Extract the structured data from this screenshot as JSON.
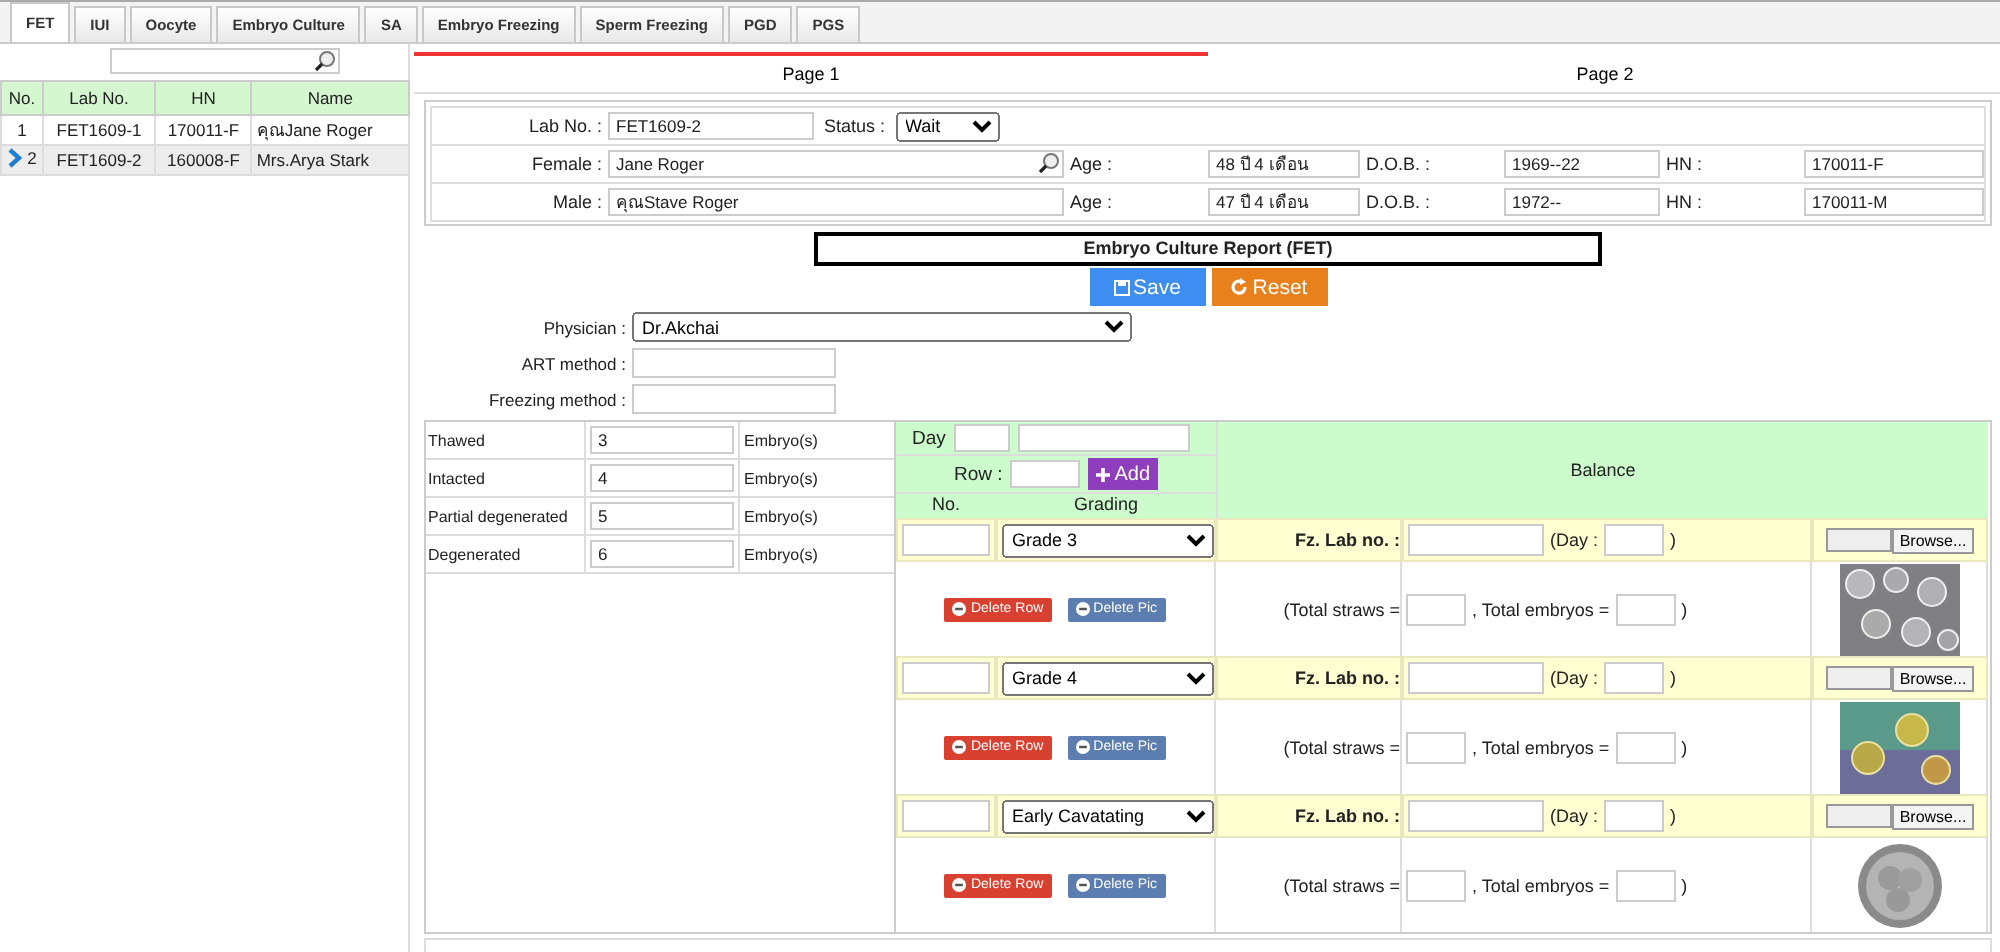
{
  "tabs": [
    {
      "label": "FET",
      "selected": true
    },
    {
      "label": "IUI",
      "selected": false
    },
    {
      "label": "Oocyte",
      "selected": false
    },
    {
      "label": "Embryo Culture",
      "selected": false
    },
    {
      "label": "SA",
      "selected": false
    },
    {
      "label": "Embryo Freezing",
      "selected": false
    },
    {
      "label": "Sperm Freezing",
      "selected": false
    },
    {
      "label": "PGD",
      "selected": false
    },
    {
      "label": "PGS",
      "selected": false
    }
  ],
  "patients": {
    "columns": [
      "No.",
      "Lab No.",
      "HN",
      "Name"
    ],
    "rows": [
      {
        "no": "1",
        "lab_no": "FET1609-1",
        "hn": "170011-F",
        "name": "คุณJane Roger",
        "selected": false
      },
      {
        "no": "2",
        "lab_no": "FET1609-2",
        "hn": "160008-F",
        "name": "Mrs.Arya Stark",
        "selected": true
      }
    ]
  },
  "pages": [
    {
      "label": "Page 1",
      "selected": true
    },
    {
      "label": "Page 2",
      "selected": false
    }
  ],
  "info": {
    "lab_no_label": "Lab No. :",
    "lab_no": "FET1609-2",
    "status_label": "Status :",
    "status": "Wait",
    "people": [
      {
        "label": "Female :",
        "name": "Jane Roger",
        "search": true,
        "age_label": "Age :",
        "age": "48 ปี 4 เดือน",
        "dob_label": "D.O.B. :",
        "dob": "1969--22",
        "hn_label": "HN :",
        "hn": "170011-F"
      },
      {
        "label": "Male :",
        "name": "คุณStave Roger",
        "search": false,
        "age_label": "Age :",
        "age": "47 ปี 4 เดือน",
        "dob_label": "D.O.B. :",
        "dob": "1972--",
        "hn_label": "HN :",
        "hn": "170011-M"
      }
    ]
  },
  "report_title": "Embryo Culture Report (FET)",
  "buttons": [
    {
      "kind": "save",
      "label": "Save"
    },
    {
      "kind": "reset",
      "label": "Reset"
    }
  ],
  "form": {
    "physician_label": "Physician :",
    "physician": "Dr.Akchai",
    "art_label": "ART method :",
    "freezing_label": "Freezing method :"
  },
  "counts": [
    {
      "label": "Thawed",
      "value": "3",
      "unit": "Embryo(s)"
    },
    {
      "label": "Intacted",
      "value": "4",
      "unit": "Embryo(s)"
    },
    {
      "label": "Partial degenerated",
      "value": "5",
      "unit": "Embryo(s)"
    },
    {
      "label": "Degenerated",
      "value": "6",
      "unit": "Embryo(s)"
    }
  ],
  "grading_panel": {
    "day_label": "Day",
    "row_label": "Row :",
    "add": "Add",
    "no_header": "No.",
    "grading_header": "Grading",
    "balance_header": "Balance"
  },
  "entries": [
    {
      "grade": "Grade 3",
      "fz_label": "Fz. Lab no. :",
      "day_label": "(Day :",
      "day_close": ")",
      "straws_label": "(Total straws =",
      "embryos_label": ", Total embryos =",
      "embryos_close": ")",
      "delete_row": "Delete Row",
      "delete_pic": "Delete Pic",
      "browse": "Browse..."
    },
    {
      "grade": "Grade 4",
      "fz_label": "Fz. Lab no. :",
      "day_label": "(Day :",
      "day_close": ")",
      "straws_label": "(Total straws =",
      "embryos_label": ", Total embryos =",
      "embryos_close": ")",
      "delete_row": "Delete Row",
      "delete_pic": "Delete Pic",
      "browse": "Browse..."
    },
    {
      "grade": "Early Cavatating",
      "fz_label": "Fz. Lab no. :",
      "day_label": "(Day :",
      "day_close": ")",
      "straws_label": "(Total straws =",
      "embryos_label": ", Total embryos =",
      "embryos_close": ")",
      "delete_row": "Delete Row",
      "delete_pic": "Delete Pic",
      "browse": "Browse..."
    }
  ]
}
